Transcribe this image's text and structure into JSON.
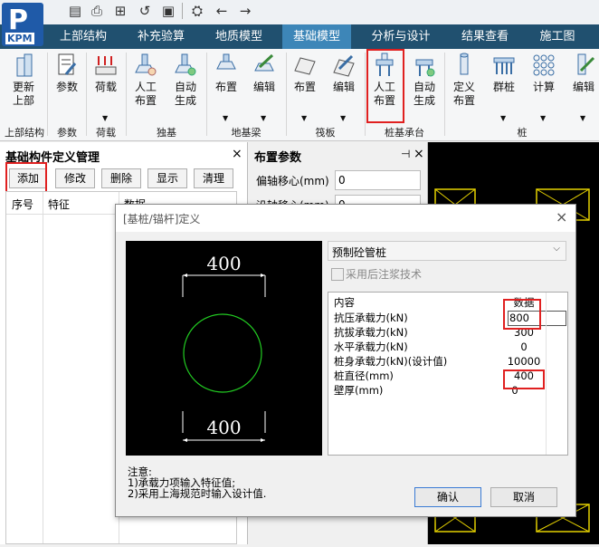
{
  "app": {
    "logo_letter": "P",
    "logo_text": "KPM"
  },
  "quick_access": [
    {
      "icon": "save-icon",
      "glyph": "▤"
    },
    {
      "icon": "print-icon",
      "glyph": "⎙"
    },
    {
      "icon": "print-preview-icon",
      "glyph": "⊞"
    },
    {
      "icon": "history-icon",
      "glyph": "↺"
    },
    {
      "icon": "export-icon",
      "glyph": "▣"
    },
    {
      "icon": "crane-icon",
      "glyph": "⛭"
    },
    {
      "icon": "back-icon",
      "glyph": "←"
    },
    {
      "icon": "forward-icon",
      "glyph": "→"
    }
  ],
  "tabs": [
    {
      "label": "上部结构",
      "active": false
    },
    {
      "label": "补充验算",
      "active": false
    },
    {
      "label": "地质模型",
      "active": false
    },
    {
      "label": "基础模型",
      "active": true
    },
    {
      "label": "分析与设计",
      "active": false
    },
    {
      "label": "结果查看",
      "active": false
    },
    {
      "label": "施工图",
      "active": false
    }
  ],
  "ribbon": {
    "buttons": [
      {
        "label1": "更新",
        "label2": "上部"
      },
      {
        "label1": "参数",
        "label2": ""
      },
      {
        "label1": "荷载",
        "label2": ""
      },
      {
        "label1": "人工",
        "label2": "布置"
      },
      {
        "label1": "自动",
        "label2": "生成"
      },
      {
        "label1": "布置",
        "label2": ""
      },
      {
        "label1": "编辑",
        "label2": ""
      },
      {
        "label1": "布置",
        "label2": ""
      },
      {
        "label1": "编辑",
        "label2": ""
      },
      {
        "label1": "人工",
        "label2": "布置"
      },
      {
        "label1": "自动",
        "label2": "生成"
      },
      {
        "label1": "定义",
        "label2": "布置"
      },
      {
        "label1": "群桩",
        "label2": ""
      },
      {
        "label1": "计算",
        "label2": ""
      },
      {
        "label1": "编辑",
        "label2": ""
      }
    ],
    "groups": [
      "上部结构",
      "参数",
      "荷载",
      "独基",
      "地基梁",
      "筏板",
      "桩基承台",
      "桩"
    ]
  },
  "left_panel": {
    "title": "基础构件定义管理",
    "close": "×",
    "buttons": [
      "添加",
      "修改",
      "删除",
      "显示",
      "清理"
    ],
    "columns": [
      "序号",
      "特征",
      "数据"
    ]
  },
  "mid_panel": {
    "title": "布置参数",
    "pin": "⊣",
    "close": "×",
    "fields": [
      {
        "label": "偏轴移心(mm)",
        "value": "0"
      },
      {
        "label": "沿轴移心(mm)",
        "value": "0"
      }
    ]
  },
  "dialog": {
    "title": "[基桩/锚杆]定义",
    "close": "×",
    "preview": {
      "top_dim": "400",
      "bottom_dim": "400"
    },
    "pile_type": "预制砼管桩",
    "checkbox_label": "采用后注浆技术",
    "props_header": {
      "key": "内容",
      "value": "数据"
    },
    "props": [
      {
        "key": "抗压承载力(kN)",
        "value": "800"
      },
      {
        "key": "抗拔承载力(kN)",
        "value": "300"
      },
      {
        "key": "水平承载力(kN)",
        "value": "0"
      },
      {
        "key": "桩身承载力(kN)(设计值)",
        "value": "10000"
      },
      {
        "key": "桩直径(mm)",
        "value": "400"
      },
      {
        "key": "壁厚(mm)",
        "value": "0"
      }
    ],
    "notes": [
      "注意:",
      "1)承载力项输入特征值;",
      "2)采用上海规范时输入设计值."
    ],
    "ok": "确认",
    "cancel": "取消"
  },
  "colors": {
    "tab_bar": "#20506f",
    "tab_active": "#3d86b8",
    "highlight": "#e02020",
    "circle": "#22cc22",
    "canvas_yellow": "#e6d200"
  }
}
